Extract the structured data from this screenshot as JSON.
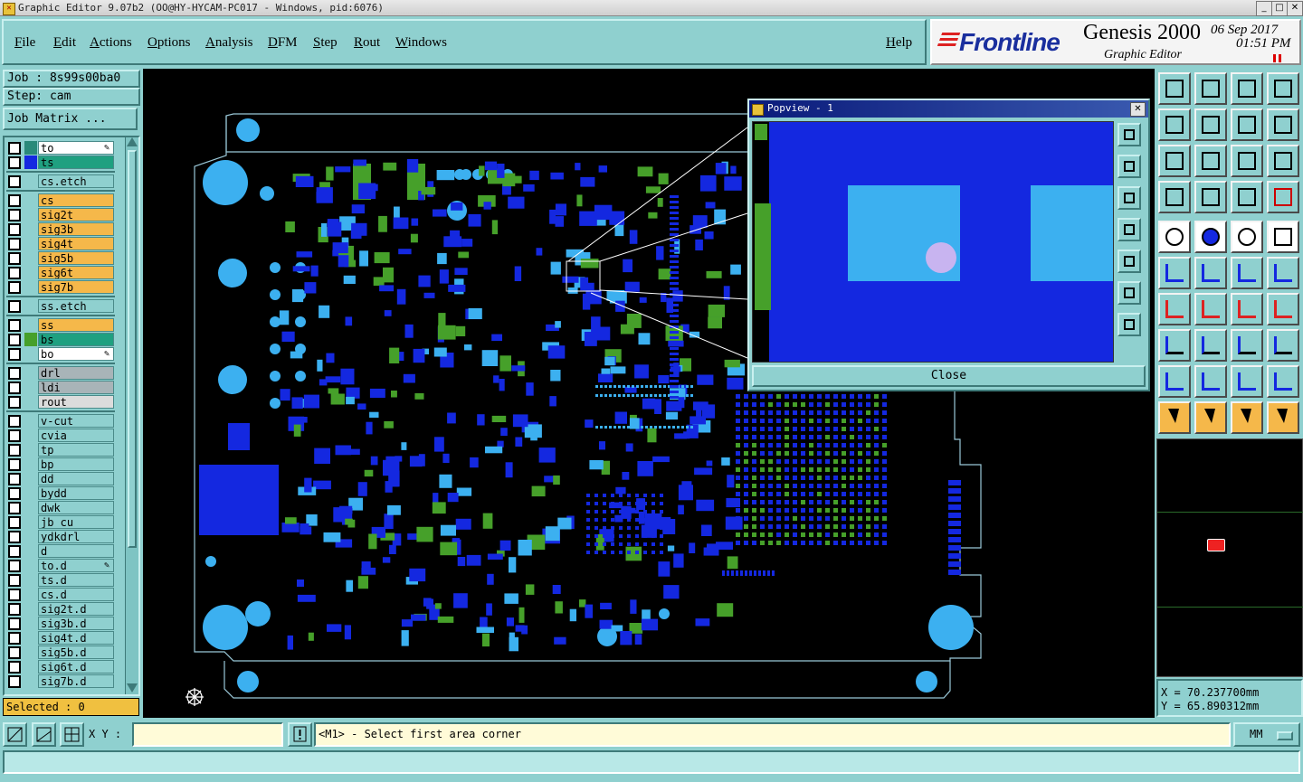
{
  "window": {
    "title": "Graphic Editor 9.07b2 (OO@HY-HYCAM-PC017 - Windows, pid:6076)",
    "min": "_",
    "max": "□",
    "close": "✕"
  },
  "menu": [
    "File",
    "Edit",
    "Actions",
    "Options",
    "Analysis",
    "DFM",
    "Step",
    "Rout",
    "Windows"
  ],
  "help_label": "Help",
  "brand": {
    "logo": "Frontline",
    "product": "Genesis 2000",
    "subtitle": "Graphic Editor",
    "date": "06 Sep 2017",
    "time": "01:51 PM"
  },
  "job": "Job : 8s99s00ba0",
  "step": "Step: cam",
  "job_matrix": "Job Matrix ...",
  "layers": [
    {
      "name": "to",
      "bg": "#ffffff",
      "swatch": "#2a8a7a",
      "edit": true
    },
    {
      "name": "ts",
      "bg": "#1fa080",
      "swatch": "#1428e0"
    },
    {
      "sep": true
    },
    {
      "name": "cs.etch",
      "bg": "#8fd0cf",
      "swatch": "#8fd0cf"
    },
    {
      "sep": true
    },
    {
      "name": "cs",
      "bg": "#f5b84a",
      "swatch": "#8fd0cf"
    },
    {
      "name": "sig2t",
      "bg": "#f5b84a",
      "swatch": "#8fd0cf"
    },
    {
      "name": "sig3b",
      "bg": "#f5b84a",
      "swatch": "#8fd0cf"
    },
    {
      "name": "sig4t",
      "bg": "#f5b84a",
      "swatch": "#8fd0cf"
    },
    {
      "name": "sig5b",
      "bg": "#f5b84a",
      "swatch": "#8fd0cf"
    },
    {
      "name": "sig6t",
      "bg": "#f5b84a",
      "swatch": "#8fd0cf"
    },
    {
      "name": "sig7b",
      "bg": "#f5b84a",
      "swatch": "#8fd0cf"
    },
    {
      "sep": true
    },
    {
      "name": "ss.etch",
      "bg": "#8fd0cf",
      "swatch": "#8fd0cf"
    },
    {
      "sep": true
    },
    {
      "name": "ss",
      "bg": "#f5b84a",
      "swatch": "#8fd0cf"
    },
    {
      "name": "bs",
      "bg": "#1fa080",
      "swatch": "#46a02a"
    },
    {
      "name": "bo",
      "bg": "#ffffff",
      "swatch": "#8fd0cf",
      "edit": true
    },
    {
      "sep": true
    },
    {
      "name": "drl",
      "bg": "#a8b4b8",
      "swatch": "#8fd0cf"
    },
    {
      "name": "ldi",
      "bg": "#a8b4b8",
      "swatch": "#8fd0cf"
    },
    {
      "name": "rout",
      "bg": "#dcdcdc",
      "swatch": "#8fd0cf"
    },
    {
      "sep": true
    },
    {
      "name": "v-cut",
      "bg": "#8fd0cf",
      "swatch": "#8fd0cf"
    },
    {
      "name": "cvia",
      "bg": "#8fd0cf",
      "swatch": "#8fd0cf"
    },
    {
      "name": "tp",
      "bg": "#8fd0cf",
      "swatch": "#8fd0cf"
    },
    {
      "name": "bp",
      "bg": "#8fd0cf",
      "swatch": "#8fd0cf"
    },
    {
      "name": "dd",
      "bg": "#8fd0cf",
      "swatch": "#8fd0cf"
    },
    {
      "name": "bydd",
      "bg": "#8fd0cf",
      "swatch": "#8fd0cf"
    },
    {
      "name": "dwk",
      "bg": "#8fd0cf",
      "swatch": "#8fd0cf"
    },
    {
      "name": "jb_cu",
      "bg": "#8fd0cf",
      "swatch": "#8fd0cf"
    },
    {
      "name": "ydkdrl",
      "bg": "#8fd0cf",
      "swatch": "#8fd0cf"
    },
    {
      "name": "d",
      "bg": "#8fd0cf",
      "swatch": "#8fd0cf"
    },
    {
      "name": "to.d",
      "bg": "#8fd0cf",
      "swatch": "#8fd0cf",
      "edit": true
    },
    {
      "name": "ts.d",
      "bg": "#8fd0cf",
      "swatch": "#8fd0cf"
    },
    {
      "name": "cs.d",
      "bg": "#8fd0cf",
      "swatch": "#8fd0cf"
    },
    {
      "name": "sig2t.d",
      "bg": "#8fd0cf",
      "swatch": "#8fd0cf"
    },
    {
      "name": "sig3b.d",
      "bg": "#8fd0cf",
      "swatch": "#8fd0cf"
    },
    {
      "name": "sig4t.d",
      "bg": "#8fd0cf",
      "swatch": "#8fd0cf"
    },
    {
      "name": "sig5b.d",
      "bg": "#8fd0cf",
      "swatch": "#8fd0cf"
    },
    {
      "name": "sig6t.d",
      "bg": "#8fd0cf",
      "swatch": "#8fd0cf"
    },
    {
      "name": "sig7b.d",
      "bg": "#8fd0cf",
      "swatch": "#8fd0cf"
    }
  ],
  "selected": "Selected : 0",
  "popview": {
    "title": "Popview - 1",
    "close_label": "Close"
  },
  "coords": {
    "x": "X = 70.237700mm",
    "y": "Y = 65.890312mm"
  },
  "bottom": {
    "xy_label": "X Y :",
    "xy_value": "",
    "prompt": "<M1> - Select first area corner",
    "units": "MM"
  },
  "colors": {
    "pad_blue": "#1428e0",
    "pad_light": "#3cb0f0",
    "pad_green": "#46a02a",
    "outline": "#9ac8d8"
  }
}
